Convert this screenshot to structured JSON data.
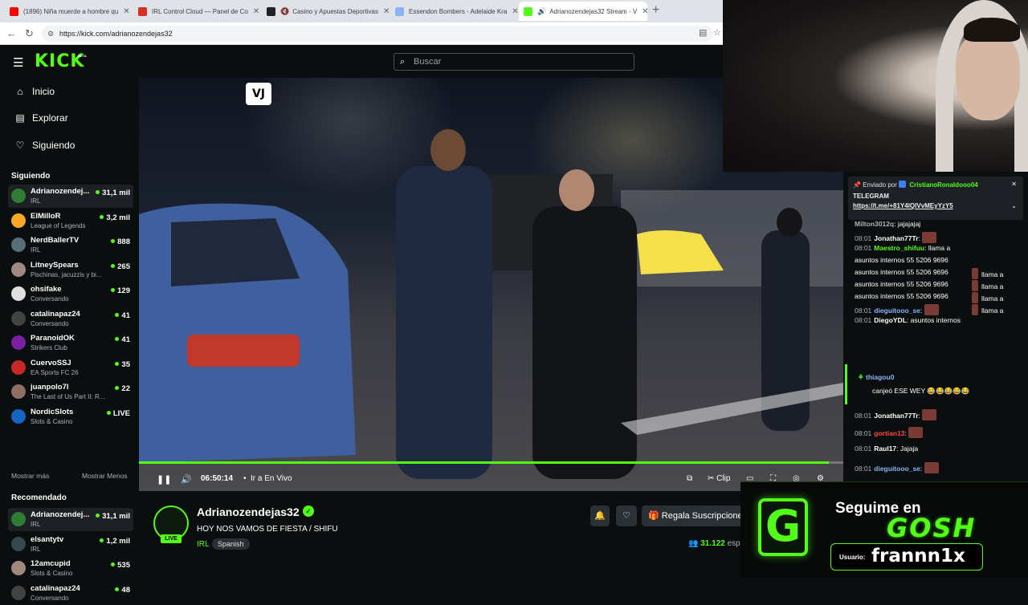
{
  "browser": {
    "tabs": [
      {
        "title": "(1896) Niña muerde a hombre qu",
        "fav_color": "#ff0000"
      },
      {
        "title": "IRL Control Cloud — Panel de Co",
        "fav_color": "#d93025"
      },
      {
        "title": "Casino y Apuestas Deportivas",
        "fav_color": "#202124"
      },
      {
        "title": "Essendon Bombers - Adelaide Kra",
        "fav_color": "#8ab4f8"
      },
      {
        "title": "Adrianozendejas32 Stream - V",
        "fav_color": "#53fc18"
      }
    ],
    "url": "https://kick.com/adrianozendejas32"
  },
  "kick": {
    "logo": "KICK",
    "beta": "BETA",
    "search_placeholder": "Buscar",
    "nav": {
      "home": "Inicio",
      "explore": "Explorar",
      "following": "Siguiendo"
    },
    "following_title": "Siguiendo",
    "following": [
      {
        "name": "Adrianozendej...",
        "category": "IRL",
        "viewers": "31,1 mil",
        "color": "#2e7d32",
        "selected": true
      },
      {
        "name": "ElMilloR",
        "category": "League of Legends",
        "viewers": "3,2 mil",
        "color": "#f9a825"
      },
      {
        "name": "NerdBallerTV",
        "category": "IRL",
        "viewers": "888",
        "color": "#546e7a"
      },
      {
        "name": "LitneySpears",
        "category": "Pischinas, jacuzzis y bi...",
        "viewers": "265",
        "color": "#a1887f"
      },
      {
        "name": "ohsifake",
        "category": "Conversando",
        "viewers": "129",
        "color": "#e0e0e0"
      },
      {
        "name": "catalinapaz24",
        "category": "Conversando",
        "viewers": "41",
        "color": "#424242"
      },
      {
        "name": "ParanoidOK",
        "category": "Strikers Club",
        "viewers": "41",
        "color": "#7b1fa2"
      },
      {
        "name": "CuervoSSJ",
        "category": "EA Sports FC 26",
        "viewers": "35",
        "color": "#c62828"
      },
      {
        "name": "juanpolo7l",
        "category": "The Last of Us Part II: R...",
        "viewers": "22",
        "color": "#8d6e63"
      },
      {
        "name": "NordicSlots",
        "category": "Slots & Casino",
        "viewers": "LIVE",
        "color": "#1565c0"
      }
    ],
    "show_more": "Mostrar más",
    "show_less": "Mostrar Menos",
    "recommended_title": "Recomendado",
    "recommended": [
      {
        "name": "Adrianozendej...",
        "category": "IRL",
        "viewers": "31,1 mil",
        "color": "#2e7d32",
        "selected": true
      },
      {
        "name": "elsantytv",
        "category": "IRL",
        "viewers": "1,2 mil",
        "color": "#37474f"
      },
      {
        "name": "12amcupid",
        "category": "Slots & Casino",
        "viewers": "535",
        "color": "#a1887f"
      },
      {
        "name": "catalinapaz24",
        "category": "Conversando",
        "viewers": "48",
        "color": "#424242"
      }
    ]
  },
  "player": {
    "watermark": "VJ",
    "time": "06:50:14",
    "go_live": "Ir a En Vivo",
    "clip": "Clip",
    "progress_fraction": 0.98
  },
  "stream": {
    "channel": "Adrianozendejas32",
    "title": "HOY NOS VAMOS DE FIESTA / SHIFU",
    "category": "IRL",
    "language": "Spanish",
    "live": "LIVE",
    "gift": "Regala Suscripcione",
    "viewers": "31.122",
    "viewers_suffix": "esp"
  },
  "chat": {
    "pinned_by": "Enviado por",
    "pinned_user": "CristianoRonaldooo04",
    "pinned_title": "TELEGRAM",
    "pinned_link": "https://t.me/+81Y4lQlVvMEyYzY5",
    "messages": [
      {
        "time": "",
        "user": "Milton3012q",
        "user_color": "#adb1b8",
        "text": ": jajajajaj"
      },
      {
        "time": "08:01",
        "user": "Jonathan77Tr",
        "user_color": "#ffffff",
        "text": ":"
      },
      {
        "time": "08:01",
        "user": "Maestro_shifuu",
        "user_color": "#53fc18",
        "text": ": llama a"
      },
      {
        "time": "",
        "user": "",
        "user_color": "#ffffff",
        "text": "asuntos internos 55 5206 9696"
      },
      {
        "time": "",
        "user": "",
        "user_color": "#ffffff",
        "text": "asuntos internos 55 5206 9696"
      },
      {
        "time": "",
        "user": "",
        "user_color": "#ffffff",
        "text": "asuntos internos 55 5206 9696"
      },
      {
        "time": "",
        "user": "",
        "user_color": "#ffffff",
        "text": "asuntos internos 55 5206 9696"
      },
      {
        "time": "08:01",
        "user": "dieguitooo_se",
        "user_color": "#8ab4f8",
        "text": ":"
      },
      {
        "time": "08:01",
        "user": "DiegoYDL",
        "user_color": "#ffffff",
        "text": ": asuntos internos"
      }
    ],
    "sub_user": "thiagou0",
    "sub_text": "canjeó ESE WEY",
    "messages2": [
      {
        "time": "08:01",
        "user": "Jonathan77Tr",
        "user_color": "#ffffff",
        "text": ":"
      },
      {
        "time": "08:01",
        "user": "gortian13",
        "user_color": "#ff4444",
        "text": ":"
      },
      {
        "time": "08:01",
        "user": "Raul17",
        "user_color": "#ffffff",
        "text": ": Jajaja"
      },
      {
        "time": "08:01",
        "user": "dieguitooo_se",
        "user_color": "#8ab4f8",
        "text": ":"
      }
    ],
    "llama": "llama a"
  },
  "overlay": {
    "follow_text": "Seguime en",
    "brand": "GOSH",
    "logo_letter": "G",
    "user_label": "Usuario:",
    "username": "frannn1x"
  }
}
